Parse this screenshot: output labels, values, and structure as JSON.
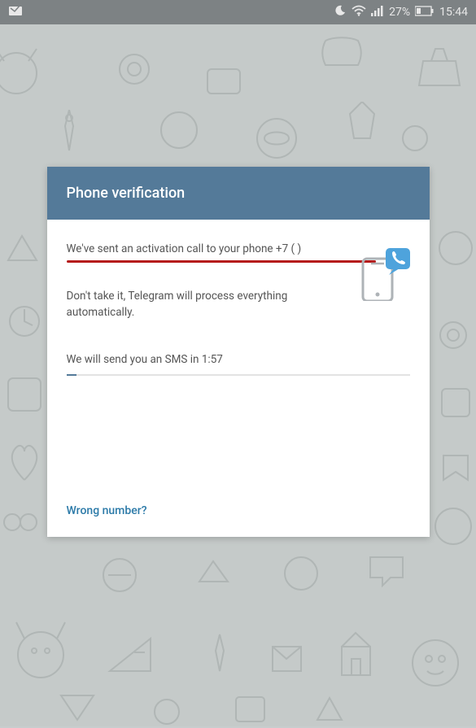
{
  "status_bar": {
    "battery_percent": "27%",
    "time": "15:44"
  },
  "card": {
    "header_title": "Phone verification",
    "activation_message": "We've sent an activation call to your phone +7 (        )",
    "dont_take_message": "Don't take it, Telegram will process everything automatically.",
    "sms_countdown": "We will send you an SMS in 1:57",
    "wrong_number_label": "Wrong number?"
  }
}
